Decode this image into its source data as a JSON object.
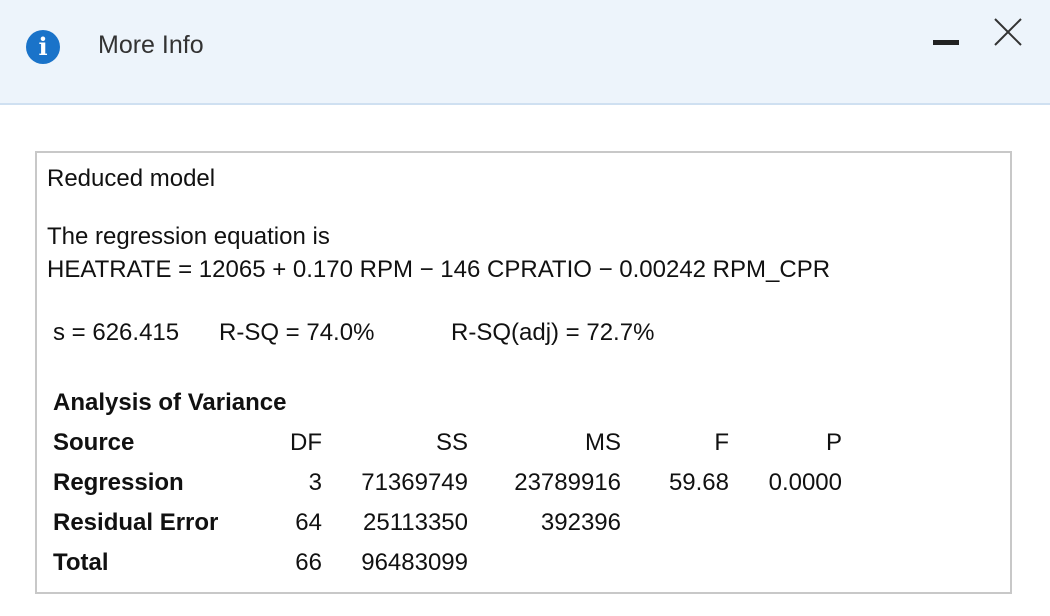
{
  "window": {
    "title": "More Info",
    "info_icon": "i",
    "icons": {
      "info": "info-circle-icon",
      "minimize": "minimize-icon",
      "close": "close-icon"
    },
    "accent_color": "#1a73c9"
  },
  "content": {
    "heading": "Reduced model",
    "equation_intro": "The regression equation is",
    "equation": "HEATRATE = 12065 + 0.170 RPM − 146 CPRATIO − 0.00242 RPM_CPR",
    "stats": {
      "s": "s = 626.415",
      "rsq": "R-SQ = 74.0%",
      "rsq_adj": "R-SQ(adj) = 72.7%"
    },
    "anova": {
      "title": "Analysis of Variance",
      "headers": {
        "source": "Source",
        "df": "DF",
        "ss": "SS",
        "ms": "MS",
        "f": "F",
        "p": "P"
      },
      "rows": [
        {
          "source": "Regression",
          "df": "3",
          "ss": "71369749",
          "ms": "23789916",
          "f": "59.68",
          "p": "0.0000"
        },
        {
          "source": "Residual Error",
          "df": "64",
          "ss": "25113350",
          "ms": "392396",
          "f": "",
          "p": ""
        },
        {
          "source": "Total",
          "df": "66",
          "ss": "96483099",
          "ms": "",
          "f": "",
          "p": ""
        }
      ]
    }
  }
}
